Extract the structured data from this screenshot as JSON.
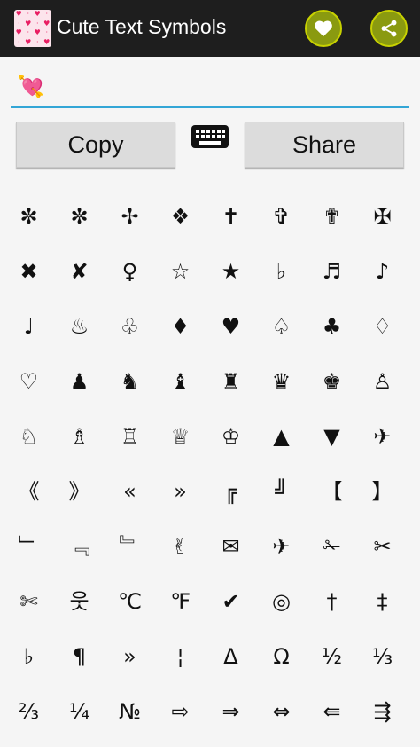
{
  "app": {
    "title": "Cute Text Symbols",
    "accent_color": "#33a6d6",
    "appbar_color": "#1e1e1e",
    "circle_button_color": "#8a9a10"
  },
  "actions": {
    "favorite_icon": "heart-icon",
    "share_icon": "share-icon"
  },
  "input": {
    "value": "💘"
  },
  "buttons": {
    "copy_label": "Copy",
    "share_label": "Share",
    "keyboard_icon": "keyboard-icon"
  },
  "symbols": [
    "✼",
    "✼",
    "✢",
    "❖",
    "✝",
    "✞",
    "✟",
    "✠",
    "✖",
    "✘",
    "♀",
    "☆",
    "★",
    "♭",
    "♬",
    "♪",
    "♩",
    "♨",
    "♧",
    "♦",
    "♥",
    "♤",
    "♣",
    "♢",
    "♡",
    "♟",
    "♞",
    "♝",
    "♜",
    "♛",
    "♚",
    "♙",
    "♘",
    "♗",
    "♖",
    "♕",
    "♔",
    "▲",
    "▼",
    "✈",
    "《",
    "》",
    "«",
    "»",
    "╔",
    "╝",
    "【",
    "】",
    "﹂",
    "﹃",
    "﹄",
    "✌",
    "✉",
    "✈",
    "✁",
    "✂",
    "✄",
    "웃",
    "℃",
    "℉",
    "✔",
    "◎",
    "†",
    "‡",
    "♭",
    "¶",
    "»",
    "¦",
    "Δ",
    "Ω",
    "½",
    "⅓",
    "⅔",
    "¼",
    "№",
    "⇨",
    "⇒",
    "⇔",
    "⇚",
    "⇶"
  ]
}
